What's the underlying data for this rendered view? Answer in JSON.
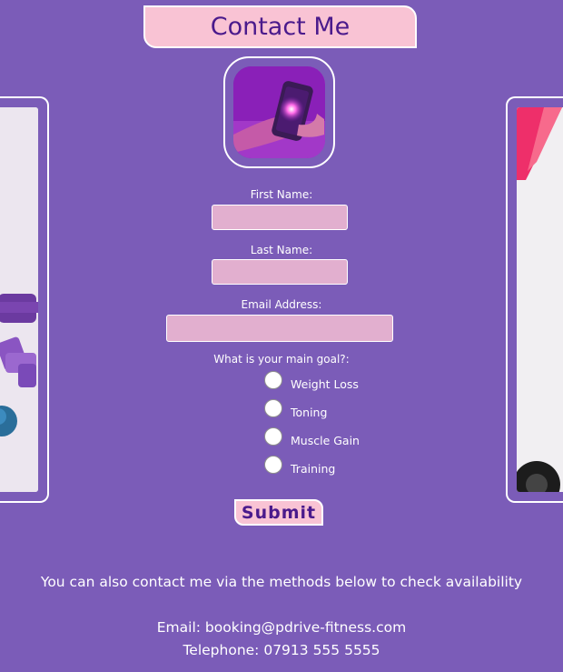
{
  "header": {
    "title": "Contact Me"
  },
  "form": {
    "first_name_label": "First Name:",
    "first_name_value": "",
    "last_name_label": "Last Name:",
    "last_name_value": "",
    "email_label": "Email Address:",
    "email_value": "",
    "goal_question": "What is your main goal?:",
    "goals": [
      "Weight Loss",
      "Toning",
      "Muscle Gain",
      "Training"
    ],
    "submit_label": "Submit"
  },
  "contact": {
    "intro": "You can also contact me via the methods below to check availability",
    "email_line": "Email: booking@pdrive-fitness.com",
    "phone_line": "Telephone: 07913 555 5555"
  },
  "colors": {
    "background": "#7b5cb8",
    "accent_pink": "#f9c3d4",
    "field_pink": "#e2afcf",
    "title_purple": "#4a1a8c"
  }
}
